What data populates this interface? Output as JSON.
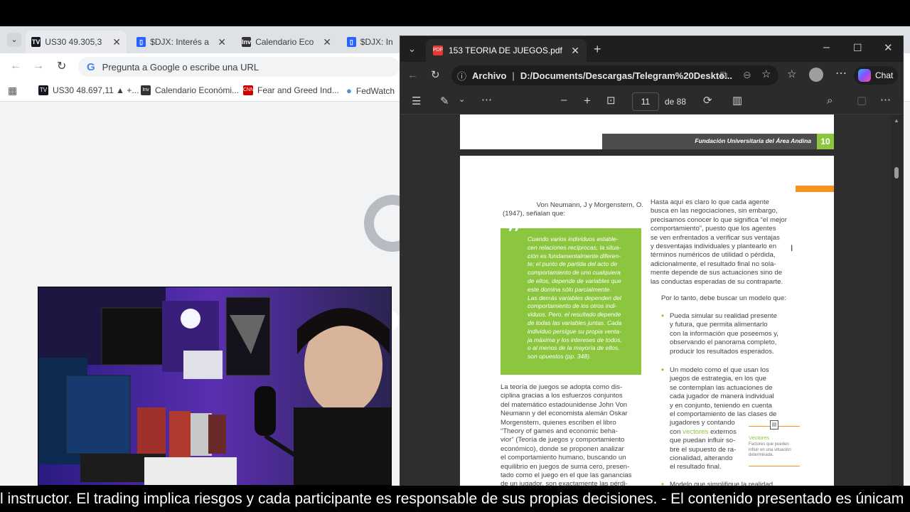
{
  "chrome": {
    "tabs": [
      {
        "label": "US30 49.305,3 ▼"
      },
      {
        "label": "$DJX: Interés ab"
      },
      {
        "label": "Calendario Econ"
      },
      {
        "label": "$DJX: Inte"
      }
    ],
    "omnibox_placeholder": "Pregunta a Google o escribe una URL",
    "bookmarks": [
      {
        "label": "US30 48.697,11 ▲ +..."
      },
      {
        "label": "Calendario Económi..."
      },
      {
        "label": "Fear and Greed Ind..."
      },
      {
        "label": "FedWatch"
      }
    ]
  },
  "edge": {
    "tab_title": "153 TEORIA DE JUEGOS.pdf",
    "address_label": "Archivo",
    "address_path": "D:/Documents/Descargas/Telegram%20Deskto...",
    "chat_label": "Chat",
    "page_number": "11",
    "page_total": "de 88"
  },
  "pdf": {
    "header_institution": "Fundación Universitaria del Área Andina",
    "header_page": "10",
    "intro_line1": "Von Neumann, J y Morgenstern, O.",
    "intro_line2": "(1947), señalan que:",
    "quote_lines": [
      "Cuando varios individuos estable-",
      "cen relaciones recíprocas, la situa-",
      "ción es fundamentalmente diferen-",
      "te; el punto de partida del acto de",
      "comportamiento de uno cualquiera",
      "de ellos, depende de variables que",
      "este domina sólo parcialmente.",
      "Las demás variables dependen del",
      "comportamiento de los otros indi-",
      "viduos. Pero, el resultado depende",
      "de todas las variables juntas. Cada",
      "individuo persigue su propia venta-",
      "ja máxima y los intereses de todos,",
      "o al menos de la mayoría de ellos,",
      "son opuestos (pp. 348)."
    ],
    "left_para_lines": [
      "La teoría de juegos se adopta como dis-",
      "ciplina gracias a los esfuerzos conjuntos",
      "del matemático estadounidense John Von",
      "Neumann y del economista alemán Oskar",
      "Morgenstern, quienes escriben el libro",
      "“Theory of games and economic beha-",
      "vior” (Teoría de juegos y comportamiento",
      "económico), donde se proponen analizar",
      "el comportamiento humano, buscando un",
      "equilibrio en juegos de suma cero, presen-",
      "tado como el juego en el que las ganancias",
      "de un jugador, son exactamente las pérdi-"
    ],
    "right_para_lines": [
      "Hasta aquí es claro lo que cada agente",
      "busca en las negociaciones, sin embargo,",
      "precisamos conocer lo que significa “el mejor",
      "comportamiento”, puesto que los agentes",
      "se ven enfrentados a verificar sus ventajas",
      "y desventajas individuales y plantearlo en",
      "términos numéricos de utilidad o pérdida,",
      "adicionalmente, el resultado final no sola-",
      "mente depende de sus actuaciones sino de",
      "las conductas esperadas de su contraparte."
    ],
    "model_intro": "Por lo tanto, debe buscar un modelo que:",
    "bullet1_lines": [
      "Pueda simular su realidad presente",
      "y futura, que permita alimentarlo",
      "con la información que poseemos y,",
      "observando el panorama completo,",
      "producir los resultados esperados."
    ],
    "bullet2_lines": [
      "Un modelo como el que usan los",
      "juegos de estrategia, en los que",
      "se contemplan las actuaciones de",
      "cada jugador de manera individual",
      "y en conjunto, teniendo en cuenta",
      "el comportamiento de las clases de",
      "jugadores y contando",
      "con",
      "vectores",
      "externos",
      "que puedan influir so-",
      "bre el supuesto de ra-",
      "cionalidad, alterando",
      "el resultado final."
    ],
    "bullet3_line": "Modelo que simplifique la realidad",
    "side_note_title": "Vectores",
    "side_note_lines": [
      "Factores que pueden",
      "influir en una situación",
      "determinada."
    ]
  },
  "caption": "l instructor. El trading implica riesgos y cada participante es responsable de sus propias decisiones.  - El contenido presentado es únicam",
  "colors": {
    "accent_green": "#8cc63f",
    "accent_orange": "#f7941d",
    "edge_bg": "#202020"
  }
}
